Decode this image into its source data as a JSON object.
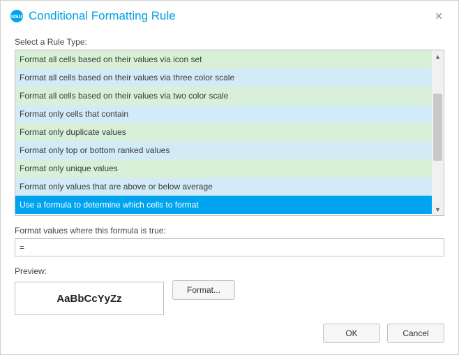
{
  "titlebar": {
    "logo_text": "usu",
    "title": "Conditional Formatting Rule",
    "close_glyph": "✕"
  },
  "labels": {
    "select_rule_type": "Select a Rule Type:",
    "formula": "Format values where this formula is true:",
    "preview": "Preview:"
  },
  "rule_types": {
    "items": [
      {
        "label": "Format all cells based on their values via icon set",
        "tone": "green",
        "selected": false
      },
      {
        "label": "Format all cells based on their values via three color scale",
        "tone": "blue",
        "selected": false
      },
      {
        "label": "Format all cells based on their values via two color scale",
        "tone": "green",
        "selected": false
      },
      {
        "label": "Format only cells that contain",
        "tone": "blue",
        "selected": false
      },
      {
        "label": "Format only duplicate values",
        "tone": "green",
        "selected": false
      },
      {
        "label": "Format only top or bottom ranked values",
        "tone": "blue",
        "selected": false
      },
      {
        "label": "Format only unique values",
        "tone": "green",
        "selected": false
      },
      {
        "label": "Format only values that are above or below average",
        "tone": "blue",
        "selected": false
      },
      {
        "label": "Use a formula to determine which cells to format",
        "tone": "green",
        "selected": true
      }
    ],
    "scroll": {
      "up_glyph": "▲",
      "down_glyph": "▼"
    }
  },
  "formula": {
    "value": "="
  },
  "preview": {
    "sample": "AaBbCcYyZz"
  },
  "buttons": {
    "format": "Format...",
    "ok": "OK",
    "cancel": "Cancel"
  },
  "theme": {
    "accent": "#009fe3",
    "selection": "#00a3f0",
    "row_green": "#d7f0d7",
    "row_blue": "#d3eaf7"
  }
}
